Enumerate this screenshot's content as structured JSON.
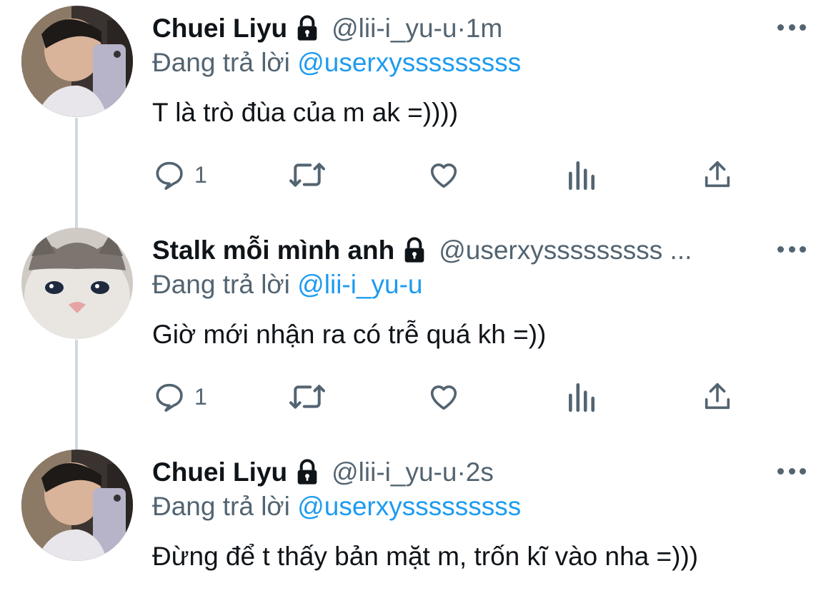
{
  "colors": {
    "text": "#0f1419",
    "secondary": "#536471",
    "link": "#1d9bf0",
    "thread_line": "#cfd9de"
  },
  "tweets": [
    {
      "name": "Chuei Liyu",
      "handle": "@lii-i_yu-u",
      "separator": " · ",
      "time": "1m",
      "replying_prefix": "Đang trả lời ",
      "replying_to": "@userxysssssssss",
      "text": "T là trò đùa của m ak =))))",
      "reply_count": "1",
      "avatar": "boy-selfie-avatar"
    },
    {
      "name": "Stalk mỗi mình anh",
      "handle": "@userxysssssssss ...",
      "separator": "",
      "time": "",
      "replying_prefix": "Đang trả lời ",
      "replying_to": "@lii-i_yu-u",
      "text": "Giờ mới nhận ra có trễ quá kh =))",
      "reply_count": "1",
      "avatar": "cat-avatar"
    },
    {
      "name": "Chuei Liyu",
      "handle": "@lii-i_yu-u",
      "separator": " · ",
      "time": "2s",
      "replying_prefix": "Đang trả lời ",
      "replying_to": "@userxysssssssss",
      "text": "Đừng để t thấy bản mặt m, trốn kĩ vào nha =)))",
      "avatar": "boy-selfie-avatar"
    }
  ]
}
